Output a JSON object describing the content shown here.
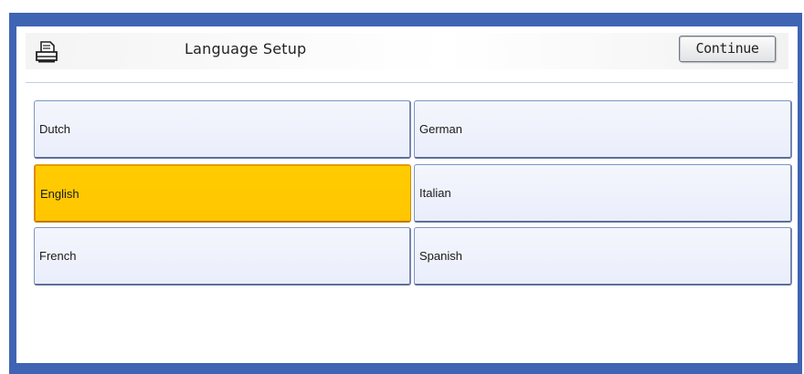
{
  "header": {
    "title": "Language Setup",
    "continue_label": "Continue",
    "icon": "printer-icon"
  },
  "languages": [
    {
      "label": "Dutch",
      "selected": false
    },
    {
      "label": "German",
      "selected": false
    },
    {
      "label": "English",
      "selected": true
    },
    {
      "label": "Italian",
      "selected": false
    },
    {
      "label": "French",
      "selected": false
    },
    {
      "label": "Spanish",
      "selected": false
    }
  ],
  "colors": {
    "frame": "#3f64b4",
    "selected": "#ffcc00",
    "button_bg": "#eaeefb"
  }
}
